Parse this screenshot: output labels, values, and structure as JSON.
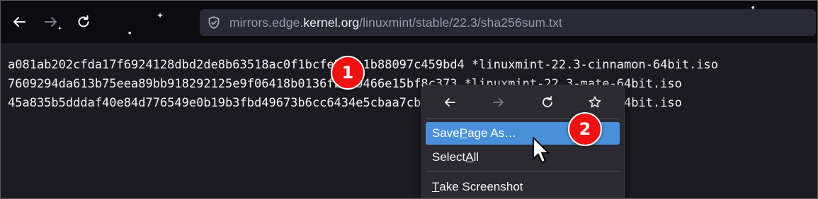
{
  "browser": {
    "url_prefix": "mirrors.edge.",
    "url_domain": "kernel.org",
    "url_path": "/linuxmint/stable/22.3/sha256sum.txt",
    "toolbar_icons": [
      "back-arrow-icon",
      "forward-arrow-icon",
      "reload-icon",
      "shield-icon"
    ]
  },
  "content": {
    "lines": [
      "a081ab202cfda17f6924128dbd2de8b63518ac0f1bcfe3f1a1b88097c459bd4 *linuxmint-22.3-cinnamon-64bit.iso",
      "7609294da613b75eea89bb918292125e9f06418b0136fb190466e15bf8c373 *linuxmint-22.3-mate-64bit.iso",
      "45a835b5dddaf40e84d776549e0b19b3fbd49673b6cc6434e5cbaa7cb1d0a7 *linuxmint-22.3-xfce-64bit.iso"
    ]
  },
  "context_menu": {
    "nav_icons": [
      "back-arrow-icon",
      "forward-arrow-icon",
      "reload-icon",
      "star-icon"
    ],
    "items": [
      {
        "pre": "Save ",
        "ul": "P",
        "post": "age As…",
        "highlighted": true
      },
      {
        "pre": "Select ",
        "ul": "A",
        "post": "ll",
        "highlighted": false
      },
      {
        "pre": "",
        "ul": "T",
        "post": "ake Screenshot",
        "highlighted": false
      }
    ]
  },
  "annotations": {
    "badge_1": "1",
    "badge_2": "2"
  },
  "colors": {
    "highlight": "#4a90d9",
    "badge": "#ee1111",
    "toolbar_bg": "#0b0b10",
    "content_bg": "#1c1b22"
  }
}
